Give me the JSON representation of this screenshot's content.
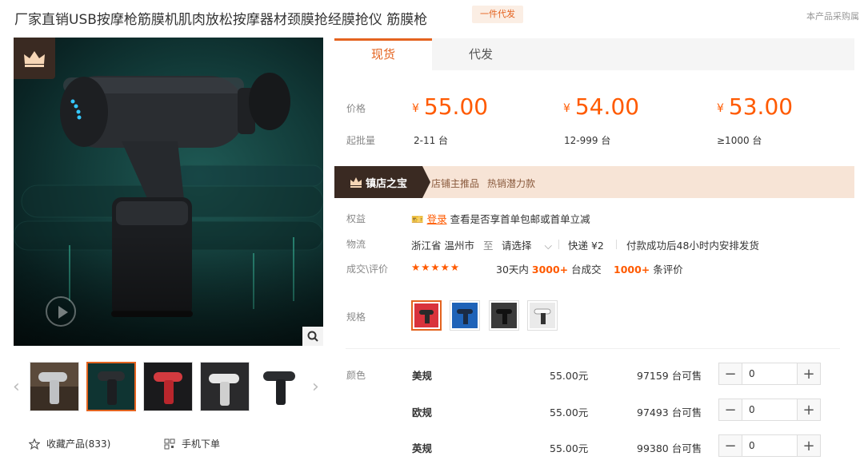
{
  "product": {
    "title": "厂家直销USB按摩枪筋膜机肌肉放松按摩器材颈膜抢经膜抢仪 筋膜枪",
    "badge": "一件代发",
    "corner_note": "本产品采购属"
  },
  "gallery": {
    "collect_label": "收藏产品(833)",
    "mobile_order_label": "手机下单"
  },
  "tabs": [
    {
      "label": "现货",
      "active": true
    },
    {
      "label": "代发",
      "active": false
    }
  ],
  "pricing": {
    "price_label": "价格",
    "moq_label": "起批量",
    "currency": "¥",
    "tiers": [
      {
        "price": "55.00",
        "moq": "2-11 台"
      },
      {
        "price": "54.00",
        "moq": "12-999 台"
      },
      {
        "price": "53.00",
        "moq": "≥1000 台"
      }
    ]
  },
  "shop": {
    "tag": "镇店之宝",
    "recommend": "店铺主推品",
    "hot": "热销潜力款"
  },
  "rights": {
    "label": "权益",
    "login": "登录",
    "text": "查看是否享首单包邮或首单立减"
  },
  "logistics": {
    "label": "物流",
    "from": "浙江省 温州市",
    "to": "至",
    "select": "请选择",
    "express": "快递 ¥2",
    "ship_note": "付款成功后48小时内安排发货"
  },
  "trade": {
    "label": "成交\\评价",
    "stars": "★★★★★",
    "days_prefix": "30天内",
    "deals": "3000+",
    "deals_suffix": "台成交",
    "reviews": "1000+",
    "reviews_suffix": "条评价"
  },
  "spec": {
    "label": "规格"
  },
  "color": {
    "label": "颜色",
    "currency_suffix": "元",
    "stock_suffix": "台可售",
    "variants": [
      {
        "name": "美规",
        "price": "55.00元",
        "stock": "97159 台可售",
        "qty": "0"
      },
      {
        "name": "欧规",
        "price": "55.00元",
        "stock": "97493 台可售",
        "qty": "0"
      },
      {
        "name": "英规",
        "price": "55.00元",
        "stock": "99380 台可售",
        "qty": "0"
      }
    ]
  },
  "colors": {
    "accent": "#ff5a00",
    "tab_active": "#e4631f",
    "shop_tag_bg": "#3a2a22",
    "shop_banner_bg": "#f7e4d6"
  }
}
